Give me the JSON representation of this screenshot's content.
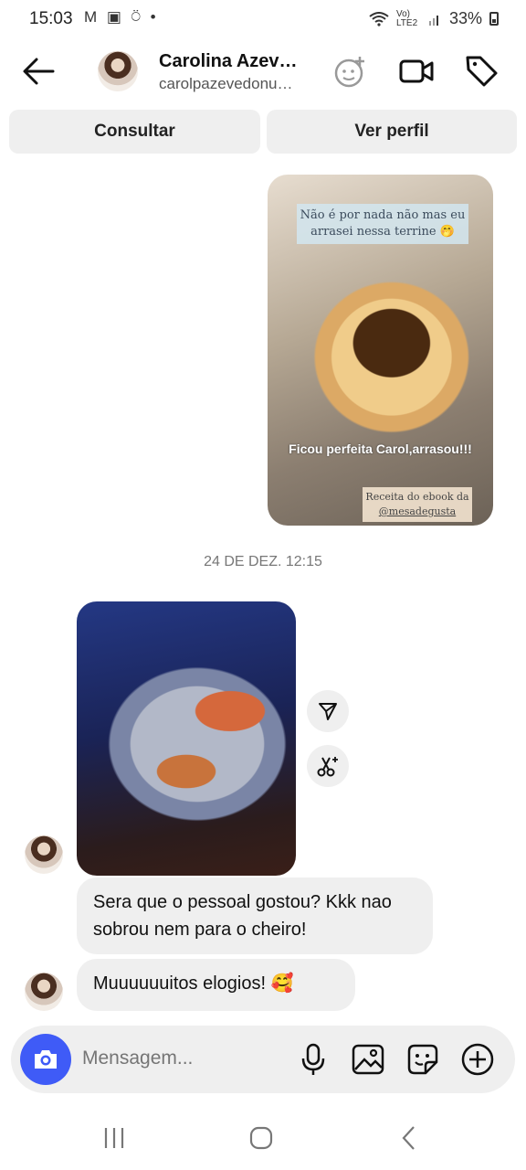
{
  "status_bar": {
    "time": "15:03",
    "left_icons": "M ▣ ⍥ •",
    "network": "Vo) LTE2",
    "battery": "33%"
  },
  "header": {
    "name": "Carolina Azev…",
    "username": "carolpazevedonu…"
  },
  "actions": {
    "consult": "Consultar",
    "view_profile": "Ver perfil"
  },
  "story_reply": {
    "caption_top": "Não é por nada não mas eu arrasei nessa terrine 🤭",
    "caption_middle": "Ficou perfeita Carol,arrasou!!!",
    "caption_bottom_line1": "Receita do ebook da",
    "caption_bottom_line2": "@mesadegusta"
  },
  "date_separator": "24 DE DEZ. 12:15",
  "messages": [
    {
      "text": "Sera que o pessoal gostou? Kkk nao sobrou nem para o cheiro!"
    },
    {
      "text": "Muuuuuuitos elogios! 🥰"
    }
  ],
  "composer": {
    "placeholder": "Mensagem..."
  },
  "icons": [
    "back-arrow-icon",
    "sticker-plus-icon",
    "video-camera-icon",
    "tag-icon",
    "send-icon",
    "scissors-sparkle-icon",
    "camera-icon",
    "microphone-icon",
    "gallery-icon",
    "sticker-icon",
    "plus-circle-icon",
    "recents-icon",
    "home-icon",
    "back-icon"
  ],
  "colors": {
    "accent": "#3f5bf7",
    "bubble": "#efefef",
    "button": "#efefef"
  }
}
